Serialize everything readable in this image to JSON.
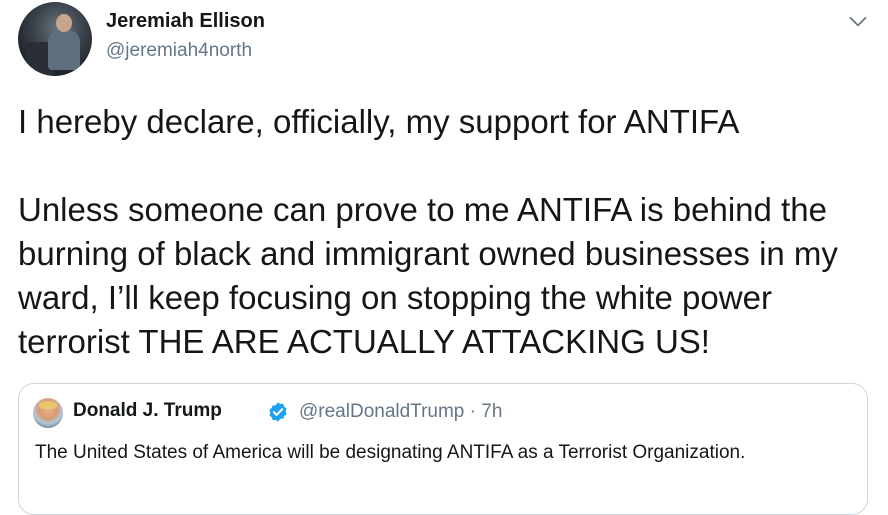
{
  "author": {
    "name": "Jeremiah Ellison",
    "handle": "@jeremiah4north"
  },
  "tweet": {
    "text": "I hereby declare, officially, my support for ANTIFA\n\nUnless someone can prove to me ANTIFA is behind the burning of black and immigrant owned businesses in my ward, I’ll keep focusing on stopping the white power terrorist THE ARE ACTUALLY ATTACKING US!"
  },
  "quoted": {
    "name": "Donald J. Trump",
    "handle_time": "@realDonaldTrump · 7h",
    "text": "The United States of America will be designating ANTIFA as a Terrorist Organization."
  },
  "colors": {
    "verified": "#1da1f2",
    "secondary_text": "#657786",
    "border": "#ccd6dd"
  },
  "icons": {
    "menu": "chevron-down-icon",
    "verified": "verified-badge-icon"
  }
}
